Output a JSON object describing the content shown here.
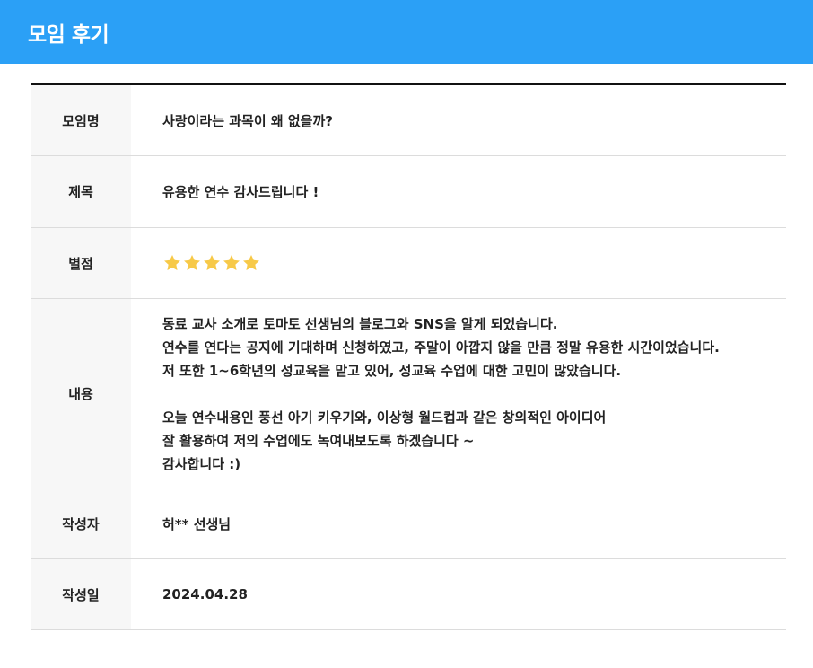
{
  "header": {
    "title": "모임 후기"
  },
  "review": {
    "meeting_label": "모임명",
    "meeting_value": "사랑이라는 과목이 왜 없을까?",
    "title_label": "제목",
    "title_value": "유용한 연수 감사드립니다 !",
    "rating_label": "별점",
    "rating_value": 5,
    "rating_max": 5,
    "content_label": "내용",
    "content_lines": [
      "동료 교사 소개로 토마토 선생님의 블로그와 SNS을 알게 되었습니다.",
      "연수를 연다는 공지에 기대하며 신청하였고, 주말이 아깝지 않을 만큼 정말 유용한 시간이었습니다.",
      "저 또한 1~6학년의 성교육을 맡고 있어, 성교육 수업에 대한 고민이 많았습니다.",
      "",
      "오늘 연수내용인 풍선 아기 키우기와, 이상형 월드컵과 같은 창의적인 아이디어",
      "잘 활용하여 저의 수업에도 녹여내보도록 하겠습니다 ~",
      "감사합니다 :)"
    ],
    "author_label": "작성자",
    "author_value": "허** 선생님",
    "date_label": "작성일",
    "date_value": "2024.04.28"
  },
  "colors": {
    "header_bg": "#2ba0f6",
    "star": "#f7c948",
    "label_bg": "#f7f7f7"
  },
  "icons": {
    "star": "star-icon"
  }
}
